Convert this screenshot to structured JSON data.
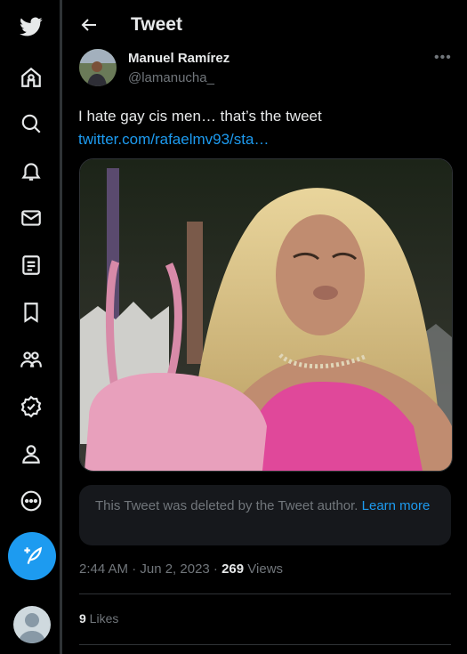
{
  "sidebar": {
    "icons": [
      "twitter-logo-icon",
      "home-icon",
      "explore-icon",
      "notifications-icon",
      "messages-icon",
      "lists-icon",
      "bookmarks-icon",
      "communities-icon",
      "verified-icon",
      "profile-icon",
      "more-icon"
    ]
  },
  "header": {
    "title": "Tweet"
  },
  "tweet": {
    "author_name": "Manuel Ramírez",
    "author_handle": "@lamanucha_",
    "text": "I hate gay cis men… that’s the tweet",
    "link": "twitter.com/rafaelmv93/sta…",
    "deleted_notice": "This Tweet was deleted by the Tweet author.",
    "deleted_learn_more": "Learn more",
    "time": "2:44 AM · Jun 2, 2023 · ",
    "views_count": "269",
    "views_label": " Views",
    "likes_count": "9",
    "likes_label": " Likes"
  },
  "colors": {
    "accent": "#1d9bf0",
    "background": "#000000",
    "muted": "#71767b"
  }
}
